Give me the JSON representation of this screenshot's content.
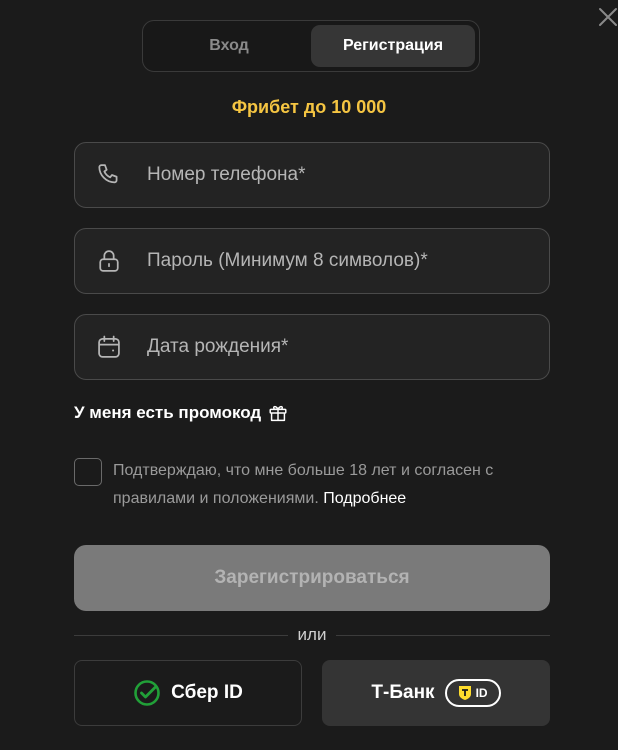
{
  "tabs": {
    "login_label": "Вход",
    "register_label": "Регистрация",
    "active": "register"
  },
  "promo": {
    "title": "Фрибет до 10 000"
  },
  "form": {
    "phone_placeholder": "Номер телефона*",
    "password_placeholder": "Пароль (Минимум 8 символов)*",
    "birthdate_placeholder": "Дата рождения*",
    "promo_code_label": "У меня есть промокод",
    "agree_text": "Подтверждаю, что мне больше 18 лет и согласен с правилами и положениями.",
    "agree_link": "Подробнее",
    "agree_checked": false,
    "submit_label": "Зарегистрироваться"
  },
  "divider": {
    "label": "или"
  },
  "social": {
    "sber_label": "Сбер ID",
    "tbank_label": "Т-Банк",
    "tbank_badge": "ID"
  },
  "icons": {
    "close": "close-icon",
    "phone": "phone-icon",
    "lock": "lock-icon",
    "calendar": "calendar-icon",
    "gift": "gift-icon",
    "sber": "sber-logo-icon",
    "tbank": "tbank-shield-icon"
  },
  "colors": {
    "background": "#1b1b1b",
    "accent_yellow": "#f5c542",
    "sber_green": "#21a038",
    "tbank_yellow": "#ffdd2d",
    "disabled_button": "#7a7a7a"
  }
}
